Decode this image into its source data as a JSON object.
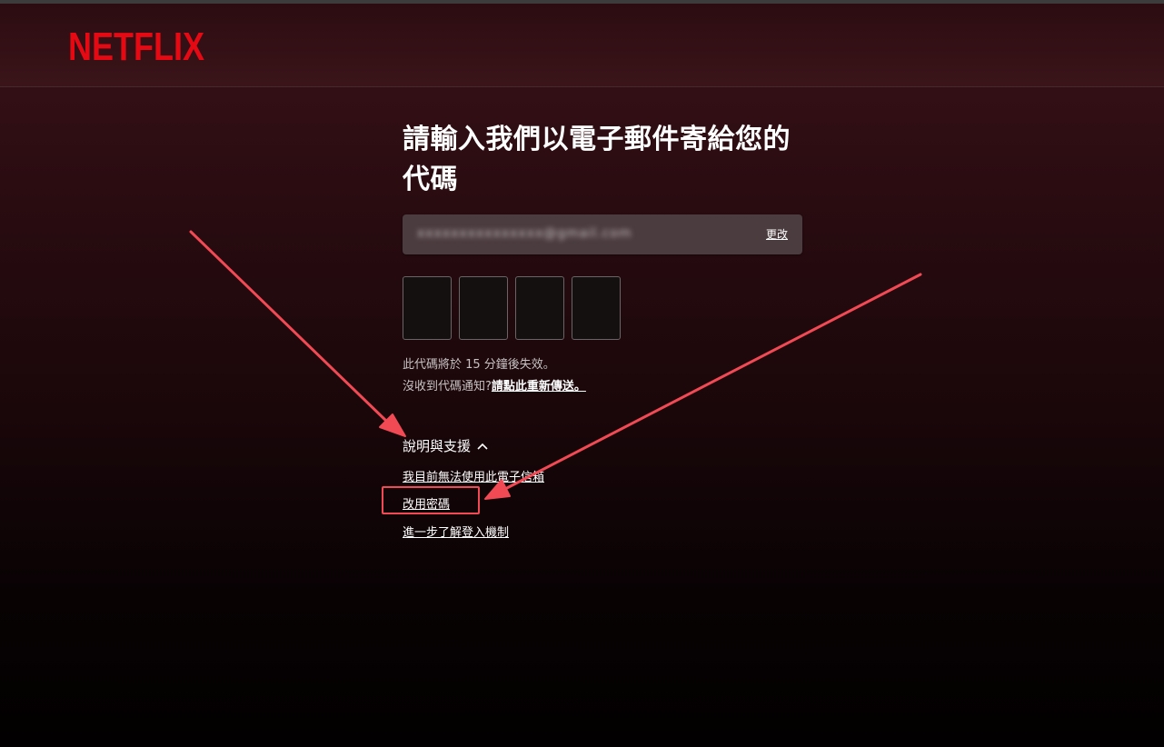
{
  "brand": {
    "logo_text": "NETFLIX",
    "logo_color": "#e50914"
  },
  "page": {
    "title": "請輸入我們以電子郵件寄給您的代碼"
  },
  "email_box": {
    "email": "xxxxxxxxxxxxxxx@gmail.com",
    "change_label": "更改"
  },
  "code": {
    "digit_count": 4,
    "expire_text": "此代碼將於 15 分鐘後失效。",
    "not_received_text": "沒收到代碼通知?",
    "resend_label": "請點此重新傳送。"
  },
  "help": {
    "toggle_label": "說明與支援",
    "links": [
      "我目前無法使用此電子信箱",
      "改用密碼",
      "進一步了解登入機制"
    ]
  },
  "annotation": {
    "arrow_color": "#f14a55",
    "highlight_target": "改用密碼"
  }
}
